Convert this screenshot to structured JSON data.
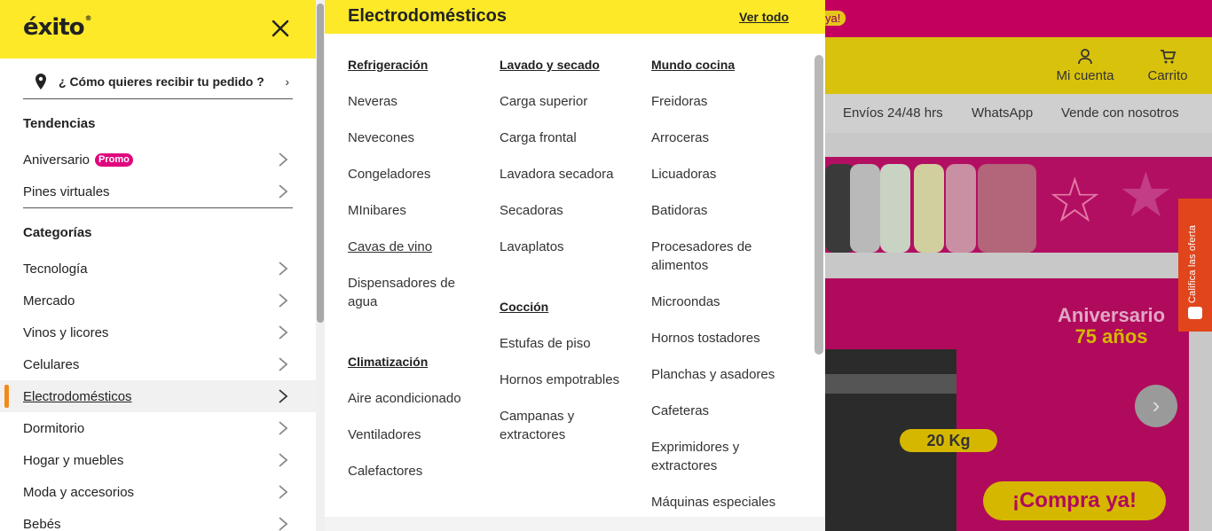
{
  "background": {
    "promo_fragment": "ya!",
    "header": {
      "account_label": "Mi cuenta",
      "cart_label": "Carrito"
    },
    "nav_links": [
      "Envíos 24/48 hrs",
      "WhatsApp",
      "Vende con nosotros"
    ],
    "banner": {
      "title_line1": "Aniversario",
      "title_line2": "75 años",
      "weight_badge": "20 Kg",
      "cta": "¡Compra ya!"
    },
    "feedback_tab": "Califica las oferta",
    "colors": {
      "brand_yellow": "#fde928",
      "brand_magenta": "#e0077d",
      "active_accent": "#f28a1a"
    }
  },
  "drawer": {
    "logo": "éxito",
    "logo_mark": "®",
    "delivery_prompt": "¿ Cómo quieres recibir tu pedido ?",
    "sections": [
      {
        "title": "Tendencias",
        "items": [
          {
            "label": "Aniversario",
            "badge": "Promo"
          },
          {
            "label": "Pines virtuales"
          }
        ]
      },
      {
        "title": "Categorías",
        "items": [
          {
            "label": "Tecnología"
          },
          {
            "label": "Mercado"
          },
          {
            "label": "Vinos y licores"
          },
          {
            "label": "Celulares"
          },
          {
            "label": "Electrodomésticos",
            "active": true
          },
          {
            "label": "Dormitorio"
          },
          {
            "label": "Hogar y muebles"
          },
          {
            "label": "Moda y accesorios"
          },
          {
            "label": "Bebés"
          }
        ]
      }
    ]
  },
  "submenu": {
    "title": "Electrodomésticos",
    "view_all": "Ver todo",
    "columns": [
      {
        "groups": [
          {
            "heading": "Refrigeración",
            "links": [
              "Neveras",
              "Nevecones",
              "Congeladores",
              "MInibares",
              "Cavas de vino",
              "Dispensadores de agua"
            ]
          },
          {
            "heading": "Climatización",
            "links": [
              "Aire acondicionado",
              "Ventiladores",
              "Calefactores"
            ]
          }
        ]
      },
      {
        "groups": [
          {
            "heading": "Lavado y secado",
            "links": [
              "Carga superior",
              "Carga frontal",
              "Lavadora secadora",
              "Secadoras",
              "Lavaplatos"
            ]
          },
          {
            "heading": "Cocción",
            "links": [
              "Estufas de piso",
              "Hornos empotrables",
              "Campanas y extractores"
            ]
          }
        ]
      },
      {
        "groups": [
          {
            "heading": "Mundo cocina",
            "links": [
              "Freidoras",
              "Arroceras",
              "Licuadoras",
              "Batidoras",
              "Procesadores de alimentos",
              "Microondas",
              "Hornos tostadores",
              "Planchas y asadores",
              "Cafeteras",
              "Exprimidores y extractores",
              "Máquinas especiales"
            ]
          }
        ]
      }
    ]
  }
}
